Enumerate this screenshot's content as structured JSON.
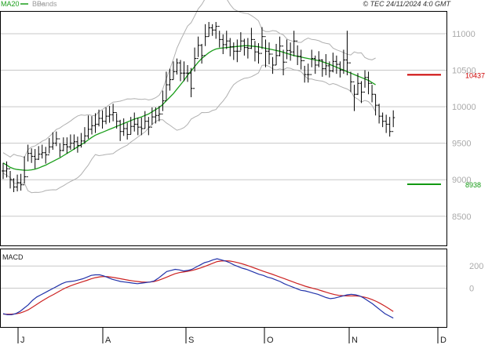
{
  "header": {
    "copyright": "© TEC 24/11/2024 4:0 GMT",
    "legend_ma20": "MA20",
    "legend_bbands": "BBands"
  },
  "colors": {
    "ohlc": "#000000",
    "ma20": "#1a9e1a",
    "bbands": "#b0b0b0",
    "resistance": "#cc0000",
    "support": "#119911",
    "macd": "#2233aa",
    "signal": "#cc2222",
    "grid": "#c8c8c8"
  },
  "chart_data": [
    {
      "type": "ohlc",
      "ylabel_ticks": [
        "8500",
        "9000",
        "9500",
        "10000",
        "10500",
        "11000"
      ],
      "ylim": [
        8100,
        11300
      ],
      "xlabel_ticks": [
        "J",
        "A",
        "S",
        "O",
        "N",
        "D"
      ],
      "levels": [
        {
          "label": "10437",
          "value": 10437,
          "color": "resistance"
        },
        {
          "label": "8938",
          "value": 8938,
          "color": "support"
        }
      ],
      "close": [
        9120,
        9150,
        9000,
        8900,
        8960,
        8930,
        9040,
        9360,
        9320,
        9280,
        9350,
        9370,
        9340,
        9450,
        9500,
        9560,
        9400,
        9480,
        9450,
        9500,
        9520,
        9470,
        9530,
        9600,
        9690,
        9740,
        9760,
        9840,
        9800,
        9870,
        9890,
        9920,
        9800,
        9660,
        9700,
        9620,
        9730,
        9760,
        9720,
        9700,
        9800,
        9720,
        9860,
        9880,
        9900,
        10080,
        10300,
        10370,
        10480,
        10600,
        10460,
        10460,
        10460,
        10250,
        10660,
        10840,
        10700,
        10960,
        11080,
        11050,
        11100,
        10920,
        10850,
        10900,
        10820,
        10760,
        10760,
        10900,
        10810,
        10800,
        10920,
        10750,
        10730,
        10960,
        10760,
        10720,
        10570,
        10700,
        10830,
        10610,
        10770,
        10750,
        10900,
        10690,
        10630,
        10440,
        10440,
        10660,
        10570,
        10640,
        10520,
        10560,
        10490,
        10620,
        10580,
        10500,
        10640,
        10600,
        10340,
        10170,
        10320,
        10200,
        10400,
        10320,
        10170,
        10020,
        9870,
        9800,
        9760,
        9660,
        9850
      ],
      "high": [
        9230,
        9250,
        9120,
        9020,
        9070,
        9080,
        9320,
        9480,
        9430,
        9420,
        9460,
        9480,
        9450,
        9570,
        9650,
        9660,
        9500,
        9580,
        9580,
        9620,
        9620,
        9590,
        9640,
        9720,
        9880,
        9870,
        9910,
        9960,
        9950,
        9990,
        10010,
        10040,
        9910,
        9820,
        9840,
        9780,
        9860,
        9920,
        9850,
        9850,
        9940,
        9860,
        9990,
        9990,
        10010,
        10220,
        10480,
        10520,
        10620,
        10660,
        10640,
        10620,
        10570,
        10530,
        10810,
        10960,
        10860,
        11130,
        11160,
        11130,
        11160,
        11040,
        10990,
        11040,
        10940,
        10880,
        10920,
        11020,
        10930,
        10940,
        11080,
        10900,
        10870,
        11090,
        10920,
        10880,
        10680,
        10860,
        10960,
        10780,
        10920,
        10880,
        11040,
        10840,
        10780,
        10560,
        10590,
        10780,
        10700,
        10760,
        10650,
        10720,
        10620,
        10740,
        10700,
        10620,
        10780,
        11040,
        10480,
        10300,
        10460,
        10350,
        10500,
        10480,
        10300,
        10170,
        10040,
        9920,
        9890,
        9860,
        9950
      ],
      "low": [
        9010,
        9030,
        8880,
        8830,
        8840,
        8850,
        8950,
        9250,
        9230,
        9150,
        9270,
        9290,
        9220,
        9360,
        9410,
        9460,
        9310,
        9390,
        9360,
        9410,
        9410,
        9370,
        9440,
        9490,
        9560,
        9620,
        9640,
        9730,
        9700,
        9760,
        9780,
        9800,
        9700,
        9530,
        9600,
        9550,
        9620,
        9660,
        9610,
        9610,
        9700,
        9610,
        9750,
        9770,
        9800,
        9940,
        10090,
        10220,
        10370,
        10440,
        10350,
        10350,
        10340,
        10130,
        10480,
        10680,
        10590,
        10830,
        10960,
        10970,
        10930,
        10810,
        10720,
        10790,
        10690,
        10640,
        10610,
        10770,
        10700,
        10660,
        10790,
        10620,
        10590,
        10790,
        10540,
        10580,
        10450,
        10570,
        10690,
        10430,
        10650,
        10630,
        10690,
        10570,
        10510,
        10330,
        10330,
        10540,
        10450,
        10540,
        10410,
        10430,
        10400,
        10470,
        10450,
        10400,
        10450,
        10430,
        10200,
        9940,
        10160,
        10050,
        10260,
        10170,
        10060,
        9880,
        9770,
        9720,
        9640,
        9590,
        9720
      ],
      "ma20": [
        9230,
        9200,
        9170,
        9150,
        9140,
        9135,
        9130,
        9130,
        9135,
        9145,
        9160,
        9180,
        9200,
        9225,
        9250,
        9275,
        9300,
        9330,
        9360,
        9390,
        9420,
        9450,
        9480,
        9510,
        9545,
        9580,
        9610,
        9630,
        9650,
        9670,
        9690,
        9710,
        9730,
        9750,
        9770,
        9790,
        9810,
        9830,
        9845,
        9860,
        9880,
        9900,
        9930,
        9960,
        9990,
        10030,
        10080,
        10130,
        10180,
        10240,
        10300,
        10360,
        10430,
        10490,
        10550,
        10610,
        10660,
        10700,
        10740,
        10770,
        10790,
        10800,
        10805,
        10810,
        10815,
        10820,
        10825,
        10830,
        10835,
        10835,
        10830,
        10825,
        10820,
        10810,
        10800,
        10790,
        10780,
        10770,
        10760,
        10745,
        10730,
        10715,
        10700,
        10690,
        10680,
        10670,
        10660,
        10650,
        10640,
        10630,
        10615,
        10600,
        10580,
        10560,
        10540,
        10520,
        10500,
        10480,
        10460,
        10440,
        10420,
        10400,
        10380,
        10360,
        10330,
        10300
      ]
    },
    {
      "type": "line",
      "name": "MACD",
      "ylabel_ticks": [
        "0",
        "200"
      ],
      "ylim": [
        -350,
        350
      ],
      "macd": [
        -230,
        -240,
        -240,
        -230,
        -210,
        -180,
        -150,
        -110,
        -80,
        -60,
        -40,
        -20,
        0,
        20,
        40,
        55,
        60,
        65,
        75,
        85,
        100,
        115,
        120,
        120,
        110,
        95,
        80,
        70,
        60,
        55,
        50,
        45,
        40,
        45,
        50,
        55,
        65,
        90,
        120,
        150,
        160,
        170,
        165,
        155,
        160,
        170,
        190,
        210,
        230,
        240,
        255,
        265,
        255,
        245,
        230,
        210,
        195,
        180,
        170,
        155,
        140,
        125,
        115,
        100,
        90,
        75,
        60,
        40,
        25,
        10,
        -5,
        -20,
        -25,
        -35,
        -45,
        -55,
        -70,
        -85,
        -95,
        -90,
        -80,
        -70,
        -60,
        -55,
        -60,
        -70,
        -90,
        -115,
        -140,
        -170,
        -200,
        -230,
        -250,
        -270
      ],
      "signal": [
        -235,
        -235,
        -234,
        -232,
        -225,
        -212,
        -195,
        -172,
        -147,
        -122,
        -99,
        -77,
        -57,
        -36,
        -15,
        4,
        20,
        34,
        47,
        59,
        71,
        84,
        95,
        102,
        105,
        103,
        98,
        92,
        85,
        78,
        71,
        65,
        60,
        56,
        54,
        55,
        60,
        70,
        84,
        100,
        115,
        130,
        140,
        146,
        152,
        160,
        170,
        182,
        195,
        210,
        225,
        240,
        245,
        247,
        245,
        238,
        229,
        219,
        207,
        194,
        180,
        167,
        153,
        140,
        127,
        114,
        100,
        86,
        72,
        58,
        44,
        31,
        18,
        7,
        -3,
        -13,
        -25,
        -37,
        -48,
        -58,
        -65,
        -68,
        -70,
        -70,
        -70,
        -73,
        -80,
        -90,
        -104,
        -120,
        -140,
        -162,
        -185,
        -210
      ]
    }
  ]
}
